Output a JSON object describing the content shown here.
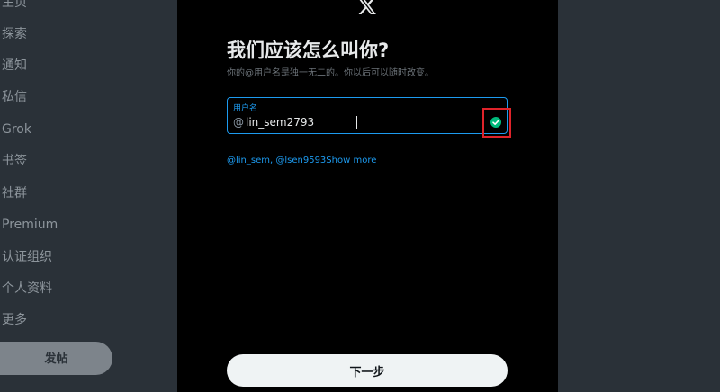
{
  "sidebar": {
    "items": [
      {
        "label": "主页"
      },
      {
        "label": "探索"
      },
      {
        "label": "通知"
      },
      {
        "label": "私信"
      },
      {
        "label": "Grok"
      },
      {
        "label": "书签"
      },
      {
        "label": "社群"
      },
      {
        "label": "Premium"
      },
      {
        "label": "认证组织"
      },
      {
        "label": "个人资料"
      },
      {
        "label": "更多"
      }
    ],
    "post_button": "发帖"
  },
  "modal": {
    "title": "我们应该怎么叫你?",
    "subtitle": "你的@用户名是独一无二的。你以后可以随时改变。",
    "field": {
      "label": "用户名",
      "prefix": "@",
      "value": "lin_sem2793"
    },
    "suggestions": {
      "items": [
        "@lin_sem",
        "@lsen9593"
      ],
      "separator": ", ",
      "show_more": "Show more"
    },
    "next_button": "下一步"
  },
  "colors": {
    "accent": "#1d9bf0",
    "valid": "#00ba7c",
    "highlight": "#e0232a"
  }
}
